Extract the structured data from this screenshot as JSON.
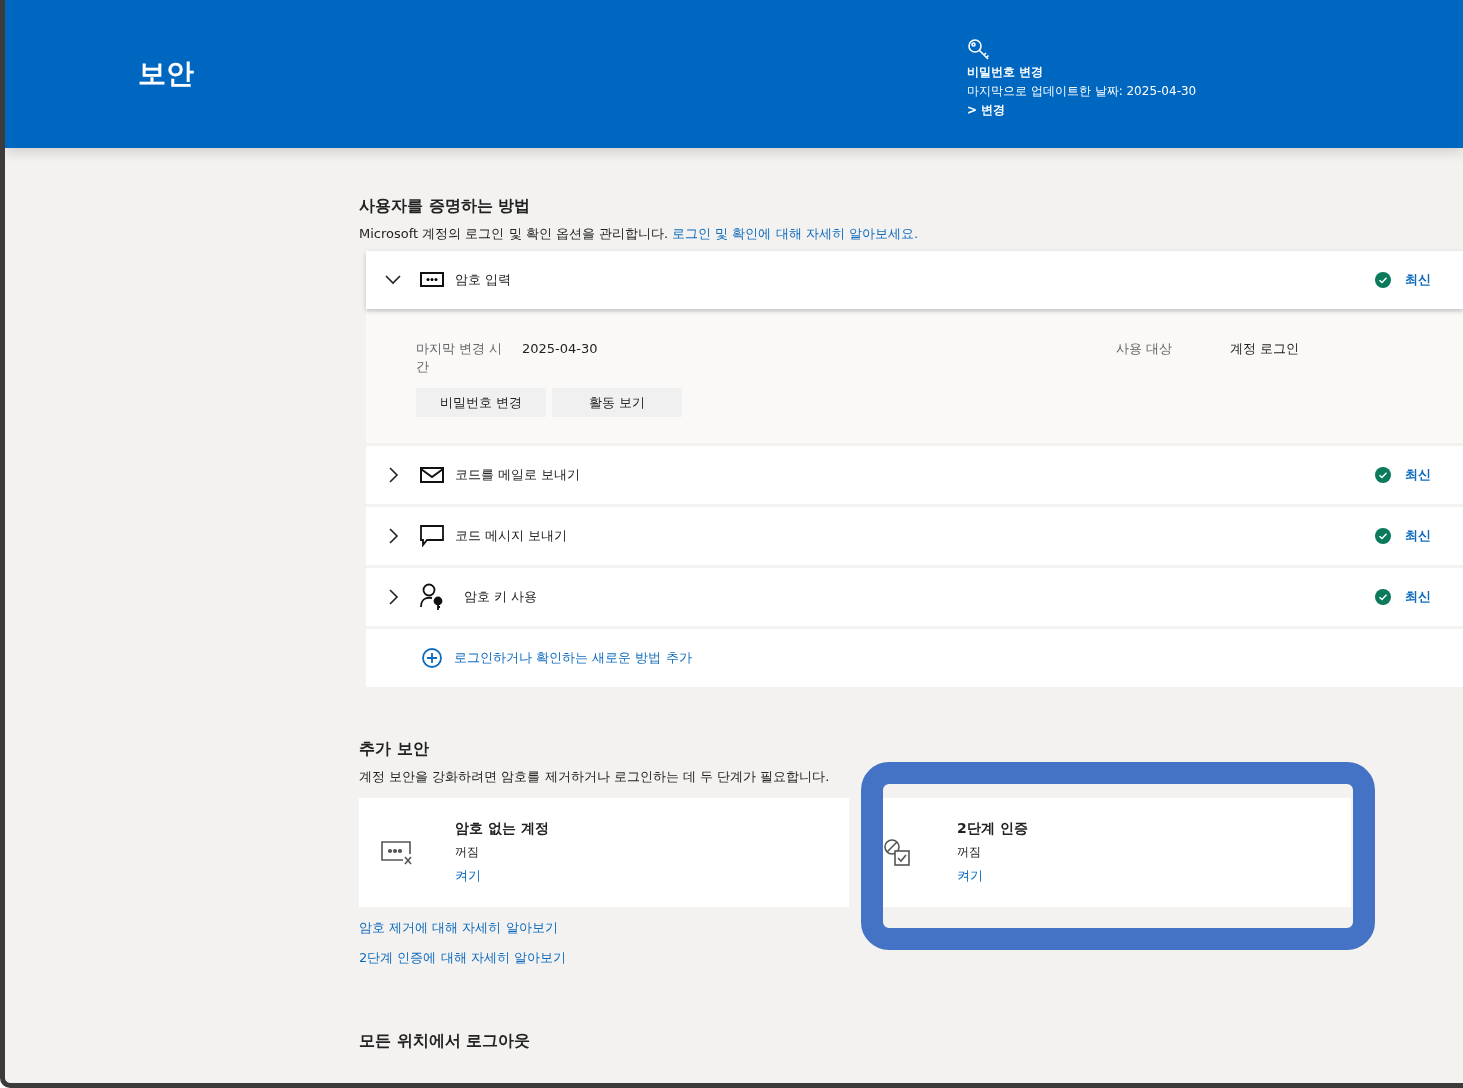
{
  "header": {
    "title": "보안",
    "password_panel": {
      "title": "비밀번호 변경",
      "updated": "마지막으로 업데이트한 날짜: 2025-04-30",
      "link": "> 변경"
    }
  },
  "methods_section": {
    "title": "사용자를 증명하는 방법",
    "description": "Microsoft 계정의 로그인 및 확인 옵션을 관리합니다.",
    "link": "로그인 및 확인에 대해 자세히 알아보세요.",
    "methods": [
      {
        "kind": "password",
        "label": "암호 입력",
        "status": "최신",
        "expanded": true,
        "details": {
          "label": "마지막 변경 시간",
          "value": "2025-04-30",
          "usage_label": "사용 대상",
          "usage_value": "계정 로그인",
          "buttons": [
            "비밀번호 변경",
            "활동 보기"
          ]
        }
      },
      {
        "kind": "email",
        "label": "코드를 메일로 보내기",
        "status": "최신",
        "expanded": false
      },
      {
        "kind": "sms",
        "label": "코드 메시지 보내기",
        "status": "최신",
        "expanded": false
      },
      {
        "kind": "passkey",
        "label": "암호 키 사용",
        "status": "최신",
        "expanded": false
      }
    ],
    "add_link": "로그인하거나 확인하는 새로운 방법 추가"
  },
  "extra_section": {
    "title": "추가 보안",
    "description": "계정 보안을 강화하려면 암호를 제거하거나 로그인하는 데 두 단계가 필요합니다.",
    "cards": [
      {
        "kind": "passwordless",
        "title": "암호 없는 계정",
        "state": "꺼짐",
        "action": "켜기",
        "highlighted": false
      },
      {
        "kind": "two_step",
        "title": "2단계 인증",
        "state": "꺼짐",
        "action": "켜기",
        "highlighted": true
      }
    ],
    "links": [
      "암호 제거에 대해 자세히 알아보기",
      "2단계 인증에 대해 자세히 알아보기"
    ]
  },
  "signout_section": {
    "title": "모든 위치에서 로그아웃"
  }
}
